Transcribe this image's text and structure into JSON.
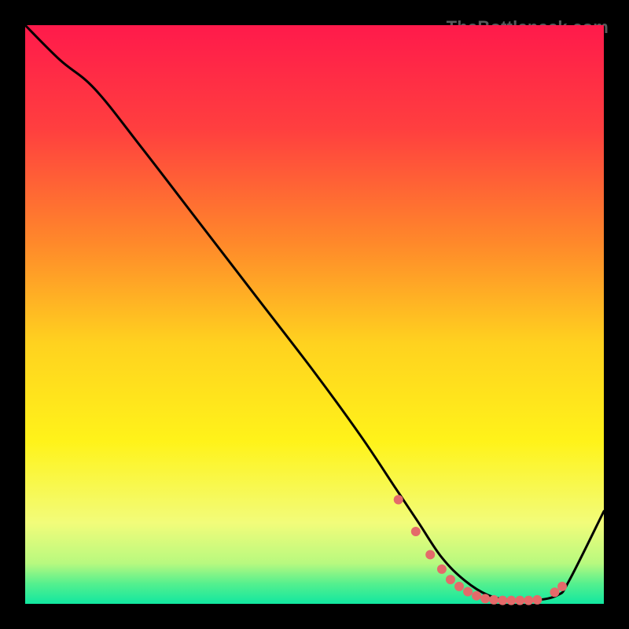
{
  "watermark": "TheBottleneck.com",
  "chart_data": {
    "type": "line",
    "title": "",
    "xlabel": "",
    "ylabel": "",
    "xlim": [
      0,
      100
    ],
    "ylim": [
      0,
      100
    ],
    "grid": false,
    "legend": false,
    "gradient_stops": [
      {
        "offset": 0.0,
        "color": "#ff1a4b"
      },
      {
        "offset": 0.18,
        "color": "#ff3f3f"
      },
      {
        "offset": 0.38,
        "color": "#ff8a2a"
      },
      {
        "offset": 0.55,
        "color": "#ffd21f"
      },
      {
        "offset": 0.72,
        "color": "#fff31a"
      },
      {
        "offset": 0.86,
        "color": "#f2fc7a"
      },
      {
        "offset": 0.93,
        "color": "#b8f97f"
      },
      {
        "offset": 0.965,
        "color": "#55f08e"
      },
      {
        "offset": 1.0,
        "color": "#11e7a0"
      }
    ],
    "series": [
      {
        "name": "curve",
        "color": "#000000",
        "x": [
          0,
          6,
          12,
          20,
          30,
          40,
          50,
          58,
          64,
          68,
          72,
          76,
          80,
          84,
          88,
          92,
          94,
          100
        ],
        "y": [
          100,
          94,
          89,
          79,
          66,
          53,
          40,
          29,
          20,
          14,
          8,
          4,
          1.5,
          0.6,
          0.6,
          1.5,
          4,
          16
        ]
      }
    ],
    "markers": {
      "name": "dots",
      "color": "#e46a6a",
      "radius_px": 6,
      "x": [
        64.5,
        67.5,
        70,
        72,
        73.5,
        75,
        76.5,
        78,
        79.5,
        81,
        82.5,
        84,
        85.5,
        87,
        88.5,
        91.5,
        92.8
      ],
      "y": [
        18,
        12.5,
        8.5,
        6,
        4.2,
        3,
        2.1,
        1.4,
        0.9,
        0.7,
        0.6,
        0.6,
        0.6,
        0.6,
        0.7,
        2.0,
        3.0
      ]
    }
  }
}
